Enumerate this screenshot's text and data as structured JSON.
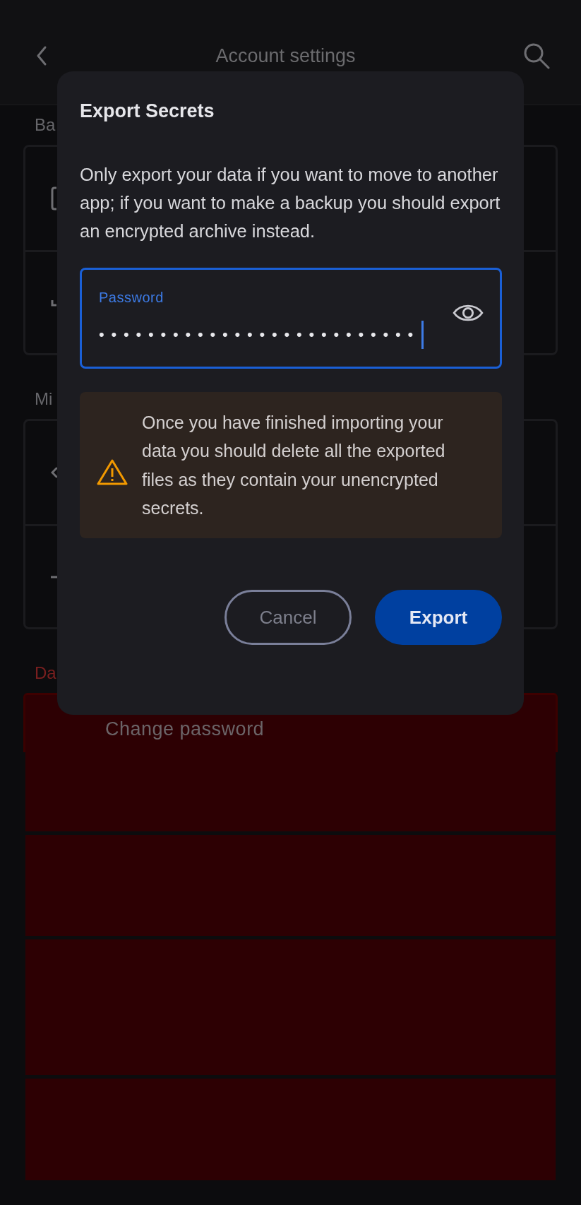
{
  "app_bar": {
    "title": "Account settings"
  },
  "sections": [
    {
      "heading": "Ba",
      "kind": "normal",
      "rows": [
        {
          "kind": "clipboard"
        },
        {
          "kind": "tray"
        }
      ]
    },
    {
      "heading": "Mi",
      "kind": "normal",
      "rows": [
        {
          "kind": "arrow"
        },
        {
          "kind": "dash"
        }
      ]
    },
    {
      "heading": "Da",
      "kind": "danger",
      "rows": [
        {
          "kind": "labeled",
          "label": "Change password"
        },
        {
          "kind": "blank"
        },
        {
          "kind": "blank"
        },
        {
          "kind": "blank"
        },
        {
          "kind": "blank"
        }
      ]
    }
  ],
  "dialog": {
    "title": "Export Secrets",
    "message": "Only export your data if you want to move to another app; if you want to make a backup you should export an encrypted archive instead.",
    "password_field": {
      "label": "Password",
      "value": "••••••••••••••••••••••••••",
      "focused": true
    },
    "warning": "Once you have finished importing your data you should delete all the exported files as they contain your unencrypted secrets.",
    "buttons": [
      {
        "label": "Cancel",
        "kind": "outlined"
      },
      {
        "label": "Export",
        "kind": "filled"
      }
    ]
  }
}
